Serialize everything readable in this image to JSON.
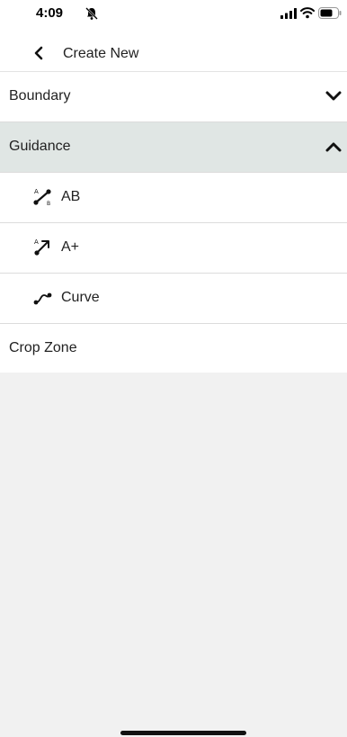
{
  "status": {
    "time": "4:09",
    "icons": [
      "bell-slash-icon",
      "signal-icon",
      "wifi-icon",
      "battery-icon"
    ]
  },
  "nav": {
    "title": "Create New",
    "back_icon": "chevron-left-icon"
  },
  "menu": [
    {
      "label": "Boundary",
      "expanded": false,
      "chevron": "chevron-down-icon"
    },
    {
      "label": "Guidance",
      "expanded": true,
      "chevron": "chevron-up-icon",
      "children": [
        {
          "label": "AB",
          "icon": "ab-line-icon"
        },
        {
          "label": "A+",
          "icon": "a-plus-icon"
        },
        {
          "label": "Curve",
          "icon": "curve-icon"
        }
      ]
    },
    {
      "label": "Crop Zone"
    }
  ],
  "colors": {
    "selected_row": "#e0e6e4",
    "empty_area": "#f1f1f1",
    "divider": "#dcdcdc"
  }
}
